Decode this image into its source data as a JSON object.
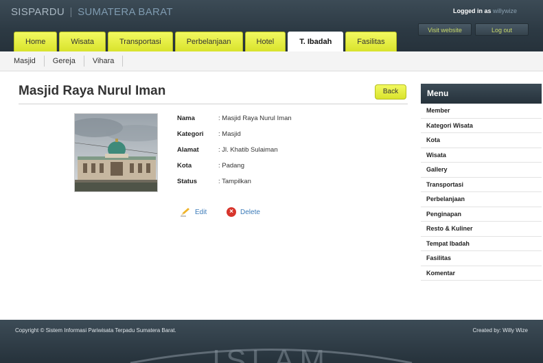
{
  "header": {
    "brand_part1": "SISPARDU",
    "brand_separator": "|",
    "brand_part2": "SUMATERA BARAT",
    "logged_in_label": "Logged in as",
    "logged_in_user": "willywize",
    "visit_button": "Visit website",
    "logout_button": "Log out"
  },
  "tabs": [
    {
      "label": "Home"
    },
    {
      "label": "Wisata"
    },
    {
      "label": "Transportasi"
    },
    {
      "label": "Perbelanjaan"
    },
    {
      "label": "Hotel"
    },
    {
      "label": "T. Ibadah",
      "active": true
    },
    {
      "label": "Fasilitas"
    }
  ],
  "subnav": [
    "Masjid",
    "Gereja",
    "Vihara"
  ],
  "page": {
    "title": "Masjid Raya Nurul Iman",
    "back_button": "Back"
  },
  "details": [
    {
      "label": "Nama",
      "value": ": Masjid Raya Nurul Iman"
    },
    {
      "label": "Kategori",
      "value": ": Masjid"
    },
    {
      "label": "Alamat",
      "value": ": Jl. Khatib Sulaiman"
    },
    {
      "label": "Kota",
      "value": ": Padang"
    },
    {
      "label": "Status",
      "value": ": Tampilkan"
    }
  ],
  "actions": {
    "edit": "Edit",
    "delete": "Delete"
  },
  "sidebar": {
    "title": "Menu",
    "items": [
      "Member",
      "Kategori Wisata",
      "Kota",
      "Wisata",
      "Gallery",
      "Transportasi",
      "Perbelanjaan",
      "Penginapan",
      "Resto & Kuliner",
      "Tempat Ibadah",
      "Fasilitas",
      "Komentar"
    ]
  },
  "footer": {
    "copyright": "Copyright © Sistem Informasi Pariwisata Terpadu Sumatera Barat.",
    "credit": "Created by: Willy Wize",
    "watermark": "ISLAM"
  },
  "colors": {
    "header_bg": "#2c3943",
    "tab_yellow": "#e6ee3c",
    "link_blue": "#3a7ab8"
  }
}
